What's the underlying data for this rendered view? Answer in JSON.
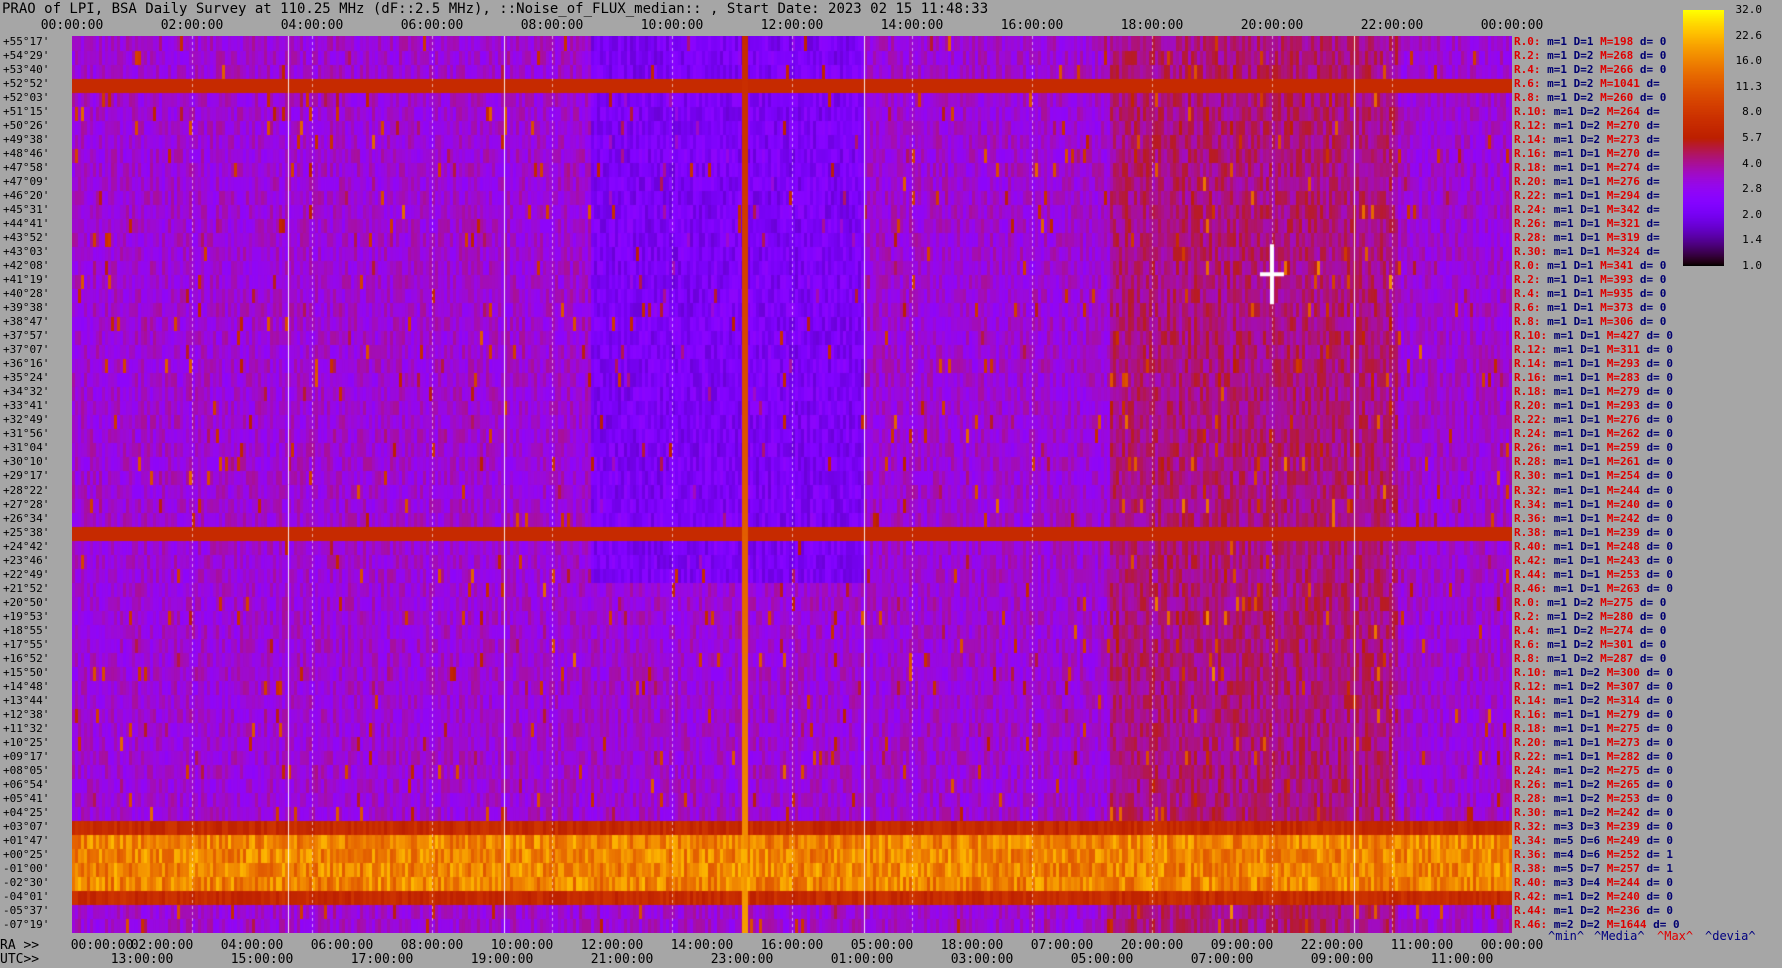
{
  "title": "PRAO of LPI, BSA Daily Survey at 110.25 MHz (dF::2.5 MHz), ::Noise_of_FLUX_median:: , Start Date: 2023 02 15 11:48:33",
  "top_ticks": [
    "00:00:00",
    "02:00:00",
    "04:00:00",
    "06:00:00",
    "08:00:00",
    "10:00:00",
    "12:00:00",
    "14:00:00",
    "16:00:00",
    "18:00:00",
    "20:00:00",
    "22:00:00",
    "00:00:00"
  ],
  "ra_prefix": "RA >>",
  "ra_ticks": [
    "00:00:00",
    "02:00:00",
    "04:00:00",
    "06:00:00",
    "08:00:00",
    "10:00:00",
    "12:00:00",
    "14:00:00",
    "16:00:00",
    "05:00:00",
    "18:00:00",
    "07:00:00",
    "20:00:00",
    "09:00:00",
    "22:00:00",
    "11:00:00",
    "00:00:00"
  ],
  "utc_prefix": "UTC>>",
  "utc_ticks": [
    "13:00:00",
    "15:00:00",
    "17:00:00",
    "19:00:00",
    "21:00:00",
    "23:00:00",
    "01:00:00",
    "03:00:00",
    "05:00:00",
    "07:00:00",
    "09:00:00",
    "11:00:00"
  ],
  "dec_labels": [
    "+55°17'",
    "+54°29'",
    "+53°40'",
    "+52°52'",
    "+52°03'",
    "+51°15'",
    "+50°26'",
    "+49°38'",
    "+48°46'",
    "+47°58'",
    "+47°09'",
    "+46°20'",
    "+45°31'",
    "+44°41'",
    "+43°52'",
    "+43°03'",
    "+42°08'",
    "+41°19'",
    "+40°28'",
    "+39°38'",
    "+38°47'",
    "+37°57'",
    "+37°07'",
    "+36°16'",
    "+35°24'",
    "+34°32'",
    "+33°41'",
    "+32°49'",
    "+31°56'",
    "+31°04'",
    "+30°10'",
    "+29°17'",
    "+28°22'",
    "+27°28'",
    "+26°34'",
    "+25°38'",
    "+24°42'",
    "+23°46'",
    "+22°49'",
    "+21°52'",
    "+20°50'",
    "+19°53'",
    "+18°55'",
    "+17°55'",
    "+16°52'",
    "+15°50'",
    "+14°48'",
    "+13°44'",
    "+12°38'",
    "+11°32'",
    "+10°25'",
    "+09°17'",
    "+08°05'",
    "+06°54'",
    "+05°41'",
    "+04°25'",
    "+03°07'",
    "+01°47'",
    "+00°25'",
    "-01°00'",
    "-02°30'",
    "-04°01'",
    "-05°37'",
    "-07°19'"
  ],
  "row_stats": [
    [
      "R.0:",
      "m=1",
      "D=1",
      "M=198",
      "d= 0"
    ],
    [
      "R.2:",
      "m=1",
      "D=2",
      "M=268",
      "d= 0"
    ],
    [
      "R.4:",
      "m=1",
      "D=2",
      "M=266",
      "d= 0"
    ],
    [
      "R.6:",
      "m=1",
      "D=2",
      "M=1041",
      "d="
    ],
    [
      "R.8:",
      "m=1",
      "D=2",
      "M=260",
      "d= 0"
    ],
    [
      "R.10:",
      "m=1",
      "D=2",
      "M=264",
      "d="
    ],
    [
      "R.12:",
      "m=1",
      "D=2",
      "M=270",
      "d="
    ],
    [
      "R.14:",
      "m=1",
      "D=2",
      "M=273",
      "d="
    ],
    [
      "R.16:",
      "m=1",
      "D=1",
      "M=270",
      "d="
    ],
    [
      "R.18:",
      "m=1",
      "D=1",
      "M=274",
      "d="
    ],
    [
      "R.20:",
      "m=1",
      "D=1",
      "M=276",
      "d="
    ],
    [
      "R.22:",
      "m=1",
      "D=1",
      "M=294",
      "d="
    ],
    [
      "R.24:",
      "m=1",
      "D=1",
      "M=342",
      "d="
    ],
    [
      "R.26:",
      "m=1",
      "D=1",
      "M=321",
      "d="
    ],
    [
      "R.28:",
      "m=1",
      "D=1",
      "M=319",
      "d="
    ],
    [
      "R.30:",
      "m=1",
      "D=1",
      "M=324",
      "d="
    ],
    [
      "R.0:",
      "m=1",
      "D=1",
      "M=341",
      "d= 0"
    ],
    [
      "R.2:",
      "m=1",
      "D=1",
      "M=393",
      "d= 0"
    ],
    [
      "R.4:",
      "m=1",
      "D=1",
      "M=935",
      "d= 0"
    ],
    [
      "R.6:",
      "m=1",
      "D=1",
      "M=373",
      "d= 0"
    ],
    [
      "R.8:",
      "m=1",
      "D=1",
      "M=306",
      "d= 0"
    ],
    [
      "R.10:",
      "m=1",
      "D=1",
      "M=427",
      "d= 0"
    ],
    [
      "R.12:",
      "m=1",
      "D=1",
      "M=311",
      "d= 0"
    ],
    [
      "R.14:",
      "m=1",
      "D=1",
      "M=293",
      "d= 0"
    ],
    [
      "R.16:",
      "m=1",
      "D=1",
      "M=283",
      "d= 0"
    ],
    [
      "R.18:",
      "m=1",
      "D=1",
      "M=279",
      "d= 0"
    ],
    [
      "R.20:",
      "m=1",
      "D=1",
      "M=293",
      "d= 0"
    ],
    [
      "R.22:",
      "m=1",
      "D=1",
      "M=276",
      "d= 0"
    ],
    [
      "R.24:",
      "m=1",
      "D=1",
      "M=262",
      "d= 0"
    ],
    [
      "R.26:",
      "m=1",
      "D=1",
      "M=259",
      "d= 0"
    ],
    [
      "R.28:",
      "m=1",
      "D=1",
      "M=261",
      "d= 0"
    ],
    [
      "R.30:",
      "m=1",
      "D=1",
      "M=254",
      "d= 0"
    ],
    [
      "R.32:",
      "m=1",
      "D=1",
      "M=244",
      "d= 0"
    ],
    [
      "R.34:",
      "m=1",
      "D=1",
      "M=240",
      "d= 0"
    ],
    [
      "R.36:",
      "m=1",
      "D=1",
      "M=242",
      "d= 0"
    ],
    [
      "R.38:",
      "m=1",
      "D=1",
      "M=239",
      "d= 0"
    ],
    [
      "R.40:",
      "m=1",
      "D=1",
      "M=248",
      "d= 0"
    ],
    [
      "R.42:",
      "m=1",
      "D=1",
      "M=243",
      "d= 0"
    ],
    [
      "R.44:",
      "m=1",
      "D=1",
      "M=253",
      "d= 0"
    ],
    [
      "R.46:",
      "m=1",
      "D=1",
      "M=263",
      "d= 0"
    ],
    [
      "R.0:",
      "m=1",
      "D=2",
      "M=275",
      "d= 0"
    ],
    [
      "R.2:",
      "m=1",
      "D=2",
      "M=280",
      "d= 0"
    ],
    [
      "R.4:",
      "m=1",
      "D=2",
      "M=274",
      "d= 0"
    ],
    [
      "R.6:",
      "m=1",
      "D=2",
      "M=301",
      "d= 0"
    ],
    [
      "R.8:",
      "m=1",
      "D=2",
      "M=287",
      "d= 0"
    ],
    [
      "R.10:",
      "m=1",
      "D=2",
      "M=300",
      "d= 0"
    ],
    [
      "R.12:",
      "m=1",
      "D=2",
      "M=307",
      "d= 0"
    ],
    [
      "R.14:",
      "m=1",
      "D=2",
      "M=314",
      "d= 0"
    ],
    [
      "R.16:",
      "m=1",
      "D=1",
      "M=279",
      "d= 0"
    ],
    [
      "R.18:",
      "m=1",
      "D=1",
      "M=275",
      "d= 0"
    ],
    [
      "R.20:",
      "m=1",
      "D=1",
      "M=273",
      "d= 0"
    ],
    [
      "R.22:",
      "m=1",
      "D=1",
      "M=282",
      "d= 0"
    ],
    [
      "R.24:",
      "m=1",
      "D=2",
      "M=275",
      "d= 0"
    ],
    [
      "R.26:",
      "m=1",
      "D=2",
      "M=265",
      "d= 0"
    ],
    [
      "R.28:",
      "m=1",
      "D=2",
      "M=253",
      "d= 0"
    ],
    [
      "R.30:",
      "m=1",
      "D=2",
      "M=242",
      "d= 0"
    ],
    [
      "R.32:",
      "m=3",
      "D=3",
      "M=239",
      "d= 0"
    ],
    [
      "R.34:",
      "m=5",
      "D=6",
      "M=249",
      "d= 0"
    ],
    [
      "R.36:",
      "m=4",
      "D=6",
      "M=252",
      "d= 1"
    ],
    [
      "R.38:",
      "m=5",
      "D=7",
      "M=257",
      "d= 1"
    ],
    [
      "R.40:",
      "m=3",
      "D=4",
      "M=244",
      "d= 0"
    ],
    [
      "R.42:",
      "m=1",
      "D=2",
      "M=240",
      "d= 0"
    ],
    [
      "R.44:",
      "m=1",
      "D=2",
      "M=236",
      "d= 0"
    ],
    [
      "R.46:",
      "m=2",
      "D=2",
      "M=1644",
      "d= 0"
    ]
  ],
  "colorbar_ticks": [
    "32.0",
    "22.6",
    "16.0",
    "11.3",
    "8.0",
    "5.7",
    "4.0",
    "2.8",
    "2.0",
    "1.4",
    "1.0"
  ],
  "legend": {
    "min": "^min^",
    "median": "^Media^",
    "max": "^Max^",
    "devia": "^devia^"
  },
  "colors": {
    "min": "#000080",
    "median": "#000080",
    "max": "#e00000",
    "devia": "#000080"
  },
  "chart_data": {
    "type": "heatmap",
    "title": "PRAO of LPI, BSA Daily Survey at 110.25 MHz (dF::2.5 MHz), ::Noise_of_FLUX_median:: , Start Date: 2023 02 15 11:48:33",
    "x_axis": "RA 00:00:00 – 24:00:00",
    "y_axis": "Declination +55°17' to -07°19'",
    "colorbar_range": [
      1.0,
      32.0
    ],
    "colormap": "gnuplot (black-purple-red-yellow-white)",
    "features": {
      "bright_bands_dec": [
        "+01°47'",
        "+00°25'",
        "-01°00'"
      ],
      "horizontal_lines_dec": [
        "+52°52'",
        "+25°38'"
      ],
      "bright_source_ra": "20:00:00",
      "bright_source_dec": "+41°19'"
    }
  }
}
